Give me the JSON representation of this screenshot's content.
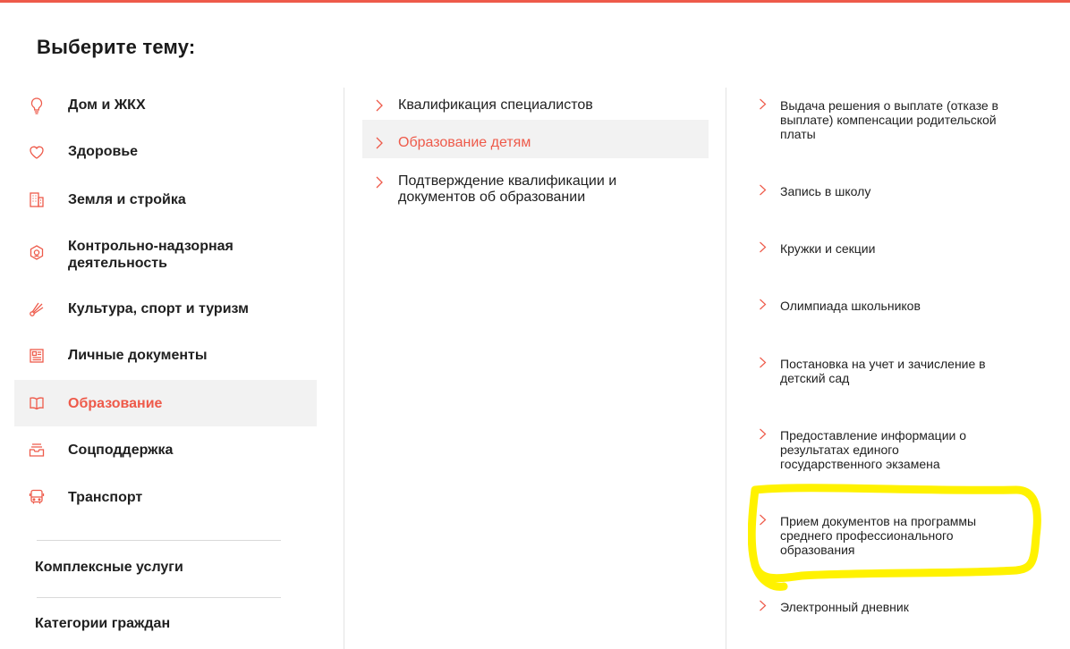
{
  "page": {
    "title": "Выберите тему:"
  },
  "colors": {
    "accent": "#ee5a4a",
    "active_bg": "#f2f2f2",
    "highlight": "#fff200"
  },
  "categories": [
    {
      "label": "Дом и ЖКХ",
      "icon": "lightbulb-icon"
    },
    {
      "label": "Здоровье",
      "icon": "heart-icon"
    },
    {
      "label": "Земля и стройка",
      "icon": "building-icon"
    },
    {
      "label": "Контрольно-надзорная деятельность",
      "icon": "shield-badge-icon"
    },
    {
      "label": "Культура, спорт и туризм",
      "icon": "shuttlecock-icon"
    },
    {
      "label": "Личные документы",
      "icon": "document-icon"
    },
    {
      "label": "Образование",
      "icon": "book-icon",
      "active": true
    },
    {
      "label": "Соцподдержка",
      "icon": "inbox-tray-icon"
    },
    {
      "label": "Транспорт",
      "icon": "bus-icon"
    }
  ],
  "extra_links": [
    "Комплексные услуги",
    "Категории граждан"
  ],
  "subcategories": [
    {
      "label": "Квалификация специалистов"
    },
    {
      "label": "Образование детям",
      "active": true
    },
    {
      "label": "Подтверждение квалификации и документов об образовании"
    }
  ],
  "services": [
    {
      "label": "Выдача решения о выплате (отказе в выплате) компенсации родительской платы"
    },
    {
      "label": "Запись в школу"
    },
    {
      "label": "Кружки и секции"
    },
    {
      "label": "Олимпиада школьников"
    },
    {
      "label": "Постановка на учет и зачисление в детский сад"
    },
    {
      "label": "Предоставление информации о результатах единого государственного экзамена"
    },
    {
      "label": "Прием документов на программы среднего профессионального образования",
      "highlighted": true
    },
    {
      "label": "Электронный дневник"
    }
  ]
}
